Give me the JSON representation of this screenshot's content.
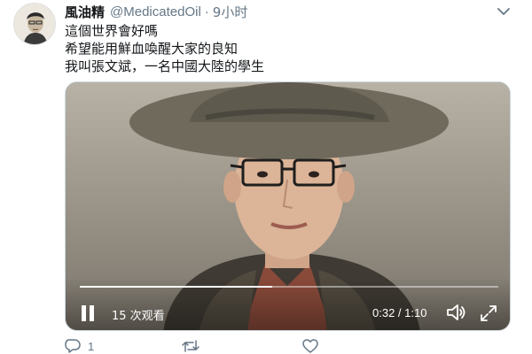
{
  "tweet": {
    "author": {
      "display_name": "風油精",
      "handle": "@MedicatedOil",
      "separator": "·",
      "time": "9小时"
    },
    "lines": [
      "這個世界會好嗎",
      "希望能用鮮血喚醒大家的良知",
      "我叫張文斌，一名中國大陸的學生"
    ],
    "video": {
      "views": "15 次观看",
      "timecode": "0:32 / 1:10",
      "progress": 0.46
    },
    "actions": {
      "reply_count": "1",
      "retweet_count": "",
      "like_count": ""
    }
  },
  "icons": {
    "caret": "chevron-down-icon",
    "pause": "pause-icon",
    "volume": "volume-icon",
    "fullscreen": "fullscreen-icon",
    "reply": "reply-icon",
    "retweet": "retweet-icon",
    "like": "like-icon"
  },
  "colors": {
    "text": "#14171a",
    "secondary": "#657786",
    "border": "#ccd6dd"
  }
}
